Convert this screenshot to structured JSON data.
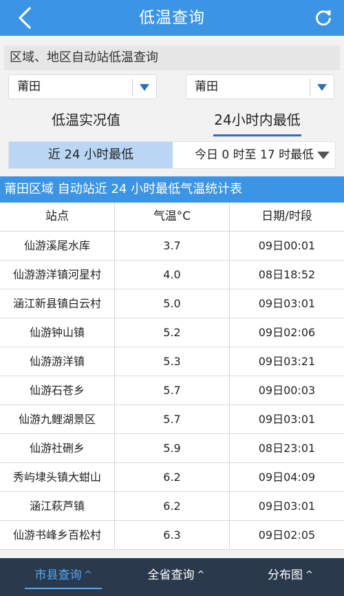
{
  "header": {
    "title": "低温查询"
  },
  "section_label": "区域、地区自动站低温查询",
  "selects": {
    "left": "莆田",
    "right": "莆田"
  },
  "tabs": [
    {
      "label": "低温实况值"
    },
    {
      "label": "24小时内最低"
    }
  ],
  "segment": {
    "left": "近 24 小时最低",
    "right": "今日 0 时至 17 时最低"
  },
  "table": {
    "title": "莆田区域 自动站近 24 小时最低气温统计表",
    "headers": [
      "站点",
      "气温°C",
      "日期/时段"
    ],
    "rows": [
      [
        "仙游溪尾水库",
        "3.7",
        "09日00:01"
      ],
      [
        "仙游游洋镇河星村",
        "4.0",
        "08日18:52"
      ],
      [
        "涵江新县镇白云村",
        "5.0",
        "09日03:01"
      ],
      [
        "仙游钟山镇",
        "5.2",
        "09日02:06"
      ],
      [
        "仙游游洋镇",
        "5.3",
        "09日03:21"
      ],
      [
        "仙游石苍乡",
        "5.7",
        "09日00:03"
      ],
      [
        "仙游九鲤湖景区",
        "5.7",
        "09日03:01"
      ],
      [
        "仙游社硎乡",
        "5.9",
        "08日23:01"
      ],
      [
        "秀屿埭头镇大蚶山",
        "6.2",
        "09日04:09"
      ],
      [
        "涵江萩芦镇",
        "6.2",
        "09日03:01"
      ],
      [
        "仙游书峰乡百松村",
        "6.3",
        "09日02:05"
      ]
    ]
  },
  "bottom_nav": [
    {
      "label": "市县查询"
    },
    {
      "label": "全省查询"
    },
    {
      "label": "分布图"
    }
  ],
  "icons": {
    "back": "chevron-left-icon",
    "refresh": "refresh-icon",
    "dropdown": "caret-down-icon",
    "nav_up": "chevron-up-icon"
  },
  "colors": {
    "primary": "#3b95e4",
    "active_segment": "#b9d7f5",
    "bottom_bar": "#2a3a4c",
    "nav_active": "#55a9f5"
  }
}
